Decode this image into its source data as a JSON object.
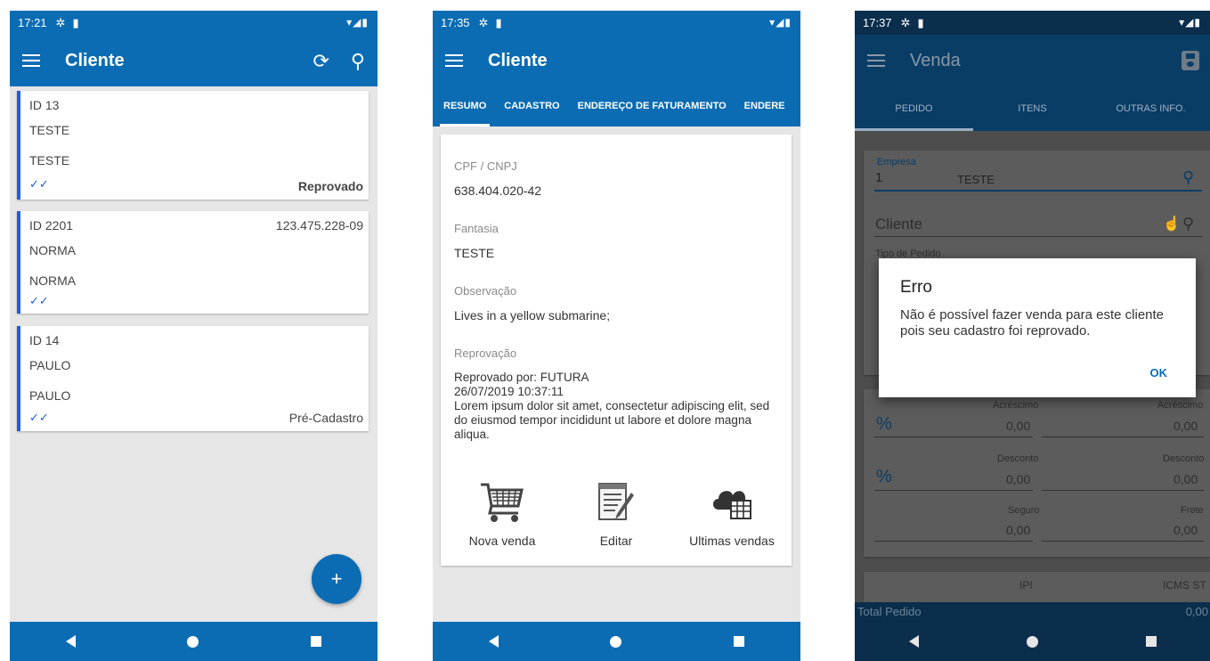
{
  "phone1": {
    "status": {
      "time": "17:21"
    },
    "appbar": {
      "title": "Cliente"
    },
    "cards": [
      {
        "id": "ID 13",
        "name1": "TESTE",
        "name2": "TESTE",
        "doc": "",
        "status": "Reprovado"
      },
      {
        "id": "ID 2201",
        "name1": "NORMA",
        "name2": "NORMA",
        "doc": "123.475.228-09",
        "status": ""
      },
      {
        "id": "ID 14",
        "name1": "PAULO",
        "name2": "PAULO",
        "doc": "",
        "status": "Pré-Cadastro"
      }
    ],
    "fab_label": "+"
  },
  "phone2": {
    "status": {
      "time": "17:35"
    },
    "appbar": {
      "title": "Cliente"
    },
    "tabs": [
      "RESUMO",
      "CADASTRO",
      "ENDEREÇO DE FATURAMENTO",
      "ENDERE"
    ],
    "fields": {
      "cpf_label": "CPF / CNPJ",
      "cpf_value": "638.404.020-42",
      "fantasia_label": "Fantasia",
      "fantasia_value": "TESTE",
      "obs_label": "Observação",
      "obs_value": "Lives in a yellow submarine;",
      "reprov_label": "Reprovação",
      "reprov_by": "Reprovado por: FUTURA",
      "reprov_date": "26/07/2019 10:37:11",
      "reprov_text": "Lorem ipsum dolor sit amet, consectetur adipiscing elit, sed do eiusmod tempor incididunt ut labore et dolore magna aliqua."
    },
    "actions": {
      "new_sale": "Nova venda",
      "edit": "Editar",
      "last_sales": "Ultimas vendas"
    }
  },
  "phone3": {
    "status": {
      "time": "17:37"
    },
    "appbar": {
      "title": "Venda"
    },
    "tabs": [
      "PEDIDO",
      "ITENS",
      "OUTRAS INFO."
    ],
    "empresa_label": "Empresa",
    "empresa_code": "1",
    "empresa_name": "TESTE",
    "cliente_placeholder": "Cliente",
    "tipo_label": "Tipo de Pedido",
    "acrescimo_label": "Acréscimo",
    "desconto_label": "Desconto",
    "seguro_label": "Seguro",
    "frete_label": "Frete",
    "percent": "%",
    "zero": "0,00",
    "ipi_label": "IPI",
    "icms_label": "ICMS ST",
    "total_label": "Total Pedido",
    "total_value": "0,00",
    "dialog": {
      "title": "Erro",
      "message": "Não é possível fazer venda para este cliente pois seu cadastro foi reprovado.",
      "ok": "OK"
    }
  }
}
